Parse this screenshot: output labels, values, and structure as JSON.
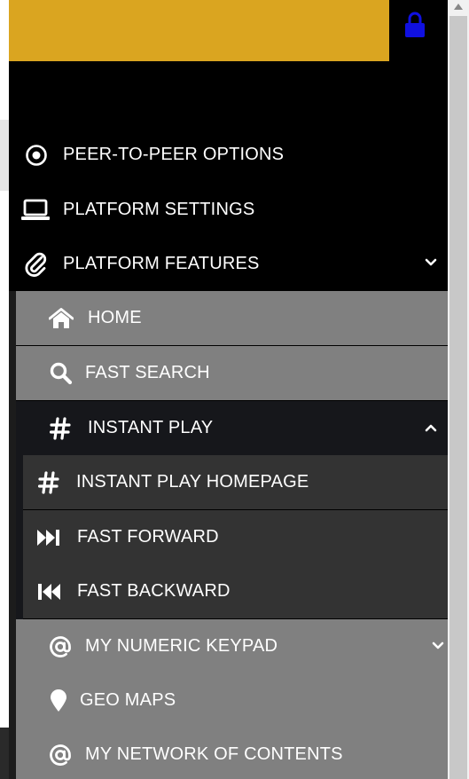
{
  "menu": {
    "peer_to_peer": "PEER-TO-PEER OPTIONS",
    "platform_settings": "PLATFORM SETTINGS",
    "platform_features": "PLATFORM FEATURES",
    "home": "HOME",
    "fast_search": "FAST SEARCH",
    "instant_play": "INSTANT PLAY",
    "instant_play_homepage": "INSTANT PLAY HOMEPAGE",
    "fast_forward": "FAST FORWARD",
    "fast_backward": "FAST BACKWARD",
    "my_numeric_keypad": "MY NUMERIC KEYPAD",
    "geo_maps": "GEO MAPS",
    "my_network_of_contents": "MY NETWORK OF CONTENTS"
  },
  "icons": {
    "lock": "lock-icon",
    "peer_to_peer": "dot-circle-icon",
    "platform_settings": "laptop-icon",
    "platform_features": "paperclip-icon",
    "home": "home-icon",
    "fast_search": "search-icon",
    "instant_play": "hashtag-icon",
    "instant_play_homepage": "hashtag-icon",
    "fast_forward": "fast-forward-icon",
    "fast_backward": "fast-backward-icon",
    "my_numeric_keypad": "at-icon",
    "geo_maps": "map-marker-icon",
    "my_network_of_contents": "at-icon"
  },
  "colors": {
    "top_bar": "#daa520",
    "lock": "#1010e0",
    "panel": "#000000",
    "submenu": "#808080",
    "active": "#16171b",
    "nested": "#333333"
  }
}
